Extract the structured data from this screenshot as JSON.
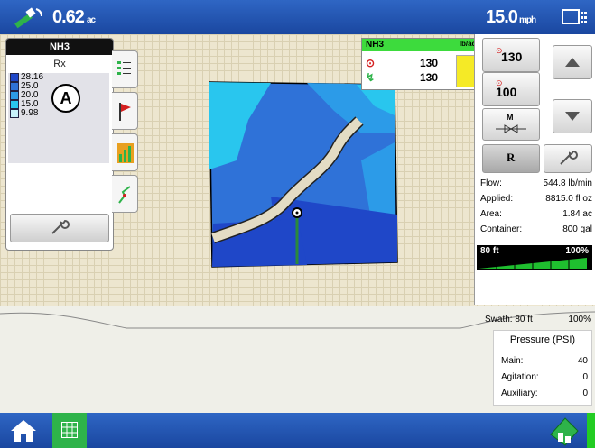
{
  "topbar": {
    "area_value": "0.62",
    "area_unit": "ac",
    "speed_value": "15.0",
    "speed_unit": "mph"
  },
  "left_panel": {
    "product": "NH3",
    "layer": "Rx",
    "legend": [
      {
        "label": "28.16",
        "color": "#1f47c8"
      },
      {
        "label": "25.0",
        "color": "#2f72d8"
      },
      {
        "label": "20.0",
        "color": "#2c9be8"
      },
      {
        "label": "15.0",
        "color": "#29c6ee"
      },
      {
        "label": "9.98",
        "color": "#c8f2fb"
      }
    ],
    "callout": "A"
  },
  "product_panel": {
    "name": "NH3",
    "unit": "lb/ac",
    "target_rate": "130",
    "actual_rate": "130"
  },
  "rate_buttons": {
    "preset_1": "130",
    "preset_2": "100",
    "manual_label": "M",
    "rx_label": "R"
  },
  "stats": [
    {
      "label": "Flow:",
      "value": "544.8 lb/min"
    },
    {
      "label": "Applied:",
      "value": "8815.0 fl oz"
    },
    {
      "label": "Area:",
      "value": "1.84 ac"
    },
    {
      "label": "Container:",
      "value": "800 gal"
    }
  ],
  "boom": {
    "width": "80 ft",
    "percent": "100%"
  },
  "swath": {
    "label": "Swath: 80 ft",
    "percent": "100%"
  },
  "pressure": {
    "title": "Pressure (PSI)",
    "rows": [
      {
        "label": "Main:",
        "value": "40"
      },
      {
        "label": "Agitation:",
        "value": "0"
      },
      {
        "label": "Auxiliary:",
        "value": "0"
      }
    ]
  }
}
